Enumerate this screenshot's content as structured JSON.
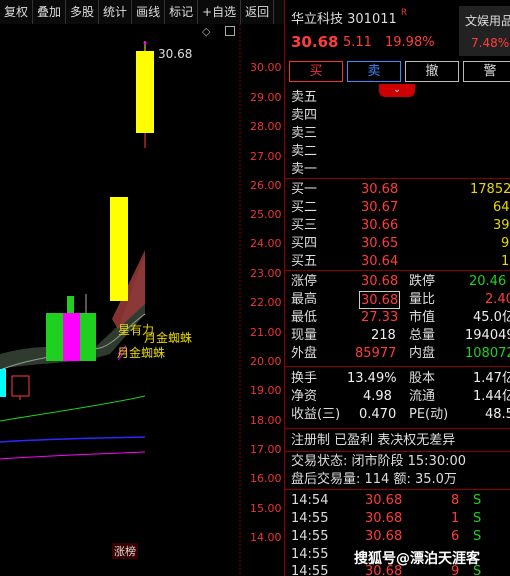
{
  "toolbar": {
    "items": [
      "复权",
      "叠加",
      "多股",
      "统计",
      "画线",
      "标记",
      "+自选",
      "返回"
    ]
  },
  "chart": {
    "high_label": "30.68",
    "price_axis": [
      "30.00",
      "29.00",
      "28.00",
      "27.00",
      "26.00",
      "25.00",
      "24.00",
      "23.00",
      "22.00",
      "21.00",
      "20.00",
      "19.00",
      "18.00",
      "17.00",
      "16.00",
      "15.00",
      "14.00"
    ],
    "annotations": {
      "xing_you_li": "星有力",
      "yue_jin_zhi_zhu_1": "月金蜘蛛",
      "yue_jin_zhi_zhu_2": "月金蜘蛛"
    },
    "zhang_bang": "涨榜"
  },
  "quote": {
    "name_code": "华立科技 301011",
    "r_mark": "R",
    "price": "30.68",
    "change": "5.11",
    "change_pct": "19.98%",
    "sector_name": "文娱用品",
    "sector_pct": "7.48%"
  },
  "buttons": {
    "buy": "买",
    "sell": "卖",
    "cancel": "撤",
    "alert": "警"
  },
  "asks": [
    {
      "label": "卖五",
      "price": "",
      "vol": ""
    },
    {
      "label": "卖四",
      "price": "",
      "vol": ""
    },
    {
      "label": "卖三",
      "price": "",
      "vol": ""
    },
    {
      "label": "卖二",
      "price": "",
      "vol": ""
    },
    {
      "label": "卖一",
      "price": "",
      "vol": ""
    }
  ],
  "bids": [
    {
      "label": "买一",
      "price": "30.68",
      "vol": "17852"
    },
    {
      "label": "买二",
      "price": "30.67",
      "vol": "64"
    },
    {
      "label": "买三",
      "price": "30.66",
      "vol": "39"
    },
    {
      "label": "买四",
      "price": "30.65",
      "vol": "9"
    },
    {
      "label": "买五",
      "price": "30.64",
      "vol": "1"
    }
  ],
  "stats": [
    {
      "l1": "涨停",
      "v1": "30.68",
      "l2": "跌停",
      "v2": "20.46"
    },
    {
      "l1": "最高",
      "v1": "30.68",
      "l2": "量比",
      "v2": "2.40"
    },
    {
      "l1": "最低",
      "v1": "27.33",
      "l2": "市值",
      "v2": "45.0亿"
    },
    {
      "l1": "现量",
      "v1": "218",
      "l2": "总量",
      "v2": "194049"
    },
    {
      "l1": "外盘",
      "v1": "85977",
      "l2": "内盘",
      "v2": "108072"
    }
  ],
  "stats2": [
    {
      "l1": "换手",
      "v1": "13.49%",
      "l2": "股本",
      "v2": "1.47亿"
    },
    {
      "l1": "净资",
      "v1": "4.98",
      "l2": "流通",
      "v2": "1.44亿"
    },
    {
      "l1": "收益(三)",
      "v1": "0.470",
      "l2": "PE(动)",
      "v2": "48.5"
    }
  ],
  "info": {
    "registration": "注册制 已盈利 表决权无差异",
    "trade_status": "交易状态: 闭市阶段 15:30:00",
    "after_hours": "盘后交易量: 114  额: 35.0万"
  },
  "ticks": [
    {
      "time": "14:54",
      "price": "30.68",
      "vol": "8",
      "side": "S"
    },
    {
      "time": "14:55",
      "price": "30.68",
      "vol": "1",
      "side": "S"
    },
    {
      "time": "14:55",
      "price": "30.68",
      "vol": "6",
      "side": "S"
    },
    {
      "time": "14:55",
      "price": "",
      "vol": "",
      "side": ""
    },
    {
      "time": "14:55",
      "price": "30.68",
      "vol": "9",
      "side": "S"
    }
  ],
  "watermark": "搜狐号@漂泊天涯客",
  "colors": {
    "up": "#ff3c3c",
    "down": "#20d020",
    "accent_yellow": "#ffff00",
    "magenta": "#ff00ff",
    "separator": "#8a0000"
  }
}
